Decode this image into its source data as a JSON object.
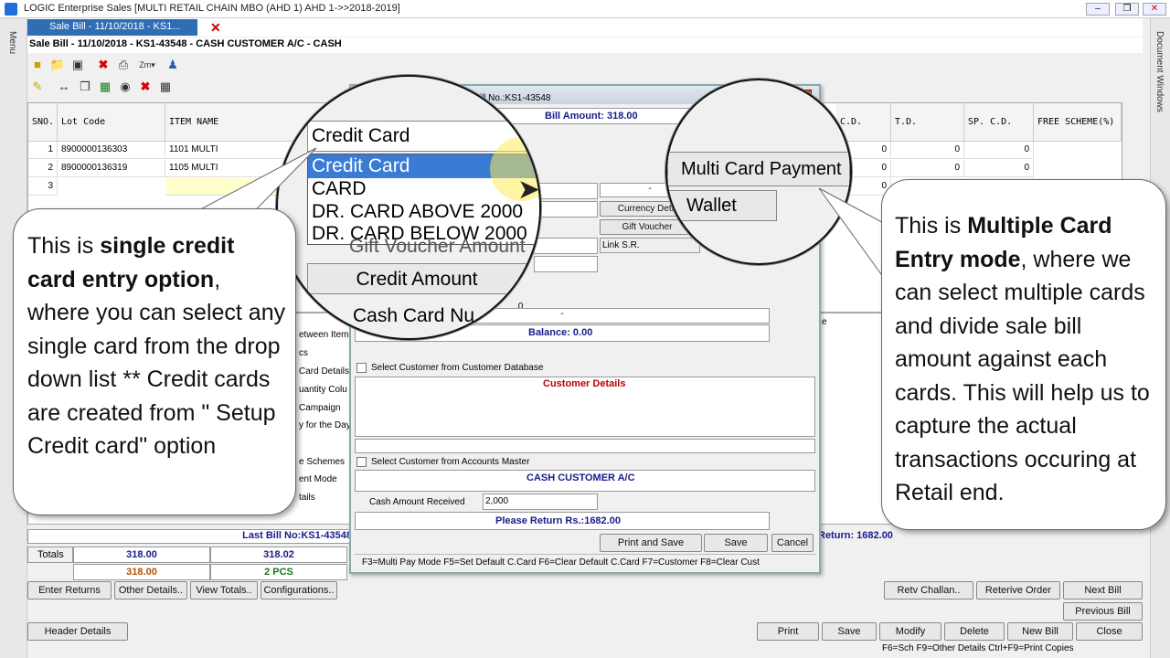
{
  "window": {
    "title": "LOGIC Enterprise Sales  [MULTI RETAIL CHAIN MBO (AHD 1) AHD 1->>2018-2019]"
  },
  "tab": {
    "label": "Sale Bill - 11/10/2018 - KS1..."
  },
  "rails": {
    "left": "Menu",
    "right": "Document Windows"
  },
  "header": {
    "line": "Sale Bill - 11/10/2018 - KS1-43548 - CASH CUSTOMER A/C - CASH"
  },
  "grid": {
    "columns": [
      "SNO.",
      "Lot Code",
      "ITEM NAME",
      "C.D.",
      "T.D.",
      "SP. C.D.",
      "FREE SCHEME(%)"
    ],
    "rows": [
      {
        "sno": "1",
        "lot": "8900000136303",
        "item": "1101 MULTI",
        "cd": "0",
        "td": "0",
        "spcd": "0"
      },
      {
        "sno": "2",
        "lot": "8900000136319",
        "item": "1105 MULTI",
        "cd": "0",
        "td": "0",
        "spcd": "0"
      },
      {
        "sno": "3",
        "lot": "",
        "item": "",
        "cd": "0",
        "td": "",
        "spcd": ""
      }
    ]
  },
  "lower_panel": {
    "items": [
      "etween Item",
      "cs",
      "Card Details",
      "uantity Colu",
      "Campaign",
      "y for the Day",
      "e Schemes",
      "ent Mode",
      "tails"
    ],
    "right_stub": "e"
  },
  "totals": {
    "last_bill": "Last Bill No:KS1-43548",
    "label": "Totals",
    "a1": "318.00",
    "a2": "318.02",
    "b1": "318.00",
    "b2": "2 PCS",
    "return_text": "Return: 1682.00"
  },
  "buttons": {
    "enter_returns": "Enter Returns",
    "other_details": "Other Details..",
    "view_totals": "View Totals..",
    "configurations": "Configurations..",
    "header_details": "Header Details",
    "retv_challan": "Retv Challan..",
    "retrieve_order": "Reterive Order",
    "next_bill": "Next Bill",
    "previous_bill": "Previous Bill",
    "print": "Print",
    "save": "Save",
    "modify": "Modify",
    "delete": "Delete",
    "new_bill": "New Bill",
    "close": "Close"
  },
  "status": {
    "shortcuts": "F6=Sch  F9=Other Details  Ctrl+F9=Print Copies"
  },
  "dialog": {
    "title": "Bill No.:KS1-43548",
    "bill_amount": "Bill Amount: 318.00",
    "dash": "-",
    "currency_btn": "Currency Deta",
    "gift_voucher_btn": "Gift Voucher",
    "link_sr": "Link S.R.",
    "fragment_zero": ".0",
    "balance": "Balance: 0.00",
    "chk_customer_db": "Select Customer from Customer Database",
    "customer_details": "Customer Details",
    "chk_accounts_master": "Select Customer from Accounts Master",
    "account_name": "CASH CUSTOMER A/C",
    "cash_label": "Cash Amount Received",
    "cash_value": "2,000",
    "please_return": "Please Return Rs.:1682.00",
    "print_save": "Print and Save",
    "save": "Save",
    "cancel": "Cancel",
    "shortcuts": "F3=Multi Pay Mode  F5=Set Default C.Card   F6=Clear Default C.Card   F7=Customer F8=Clear Cust"
  },
  "magnifier_left": {
    "selected": "Credit Card",
    "options": [
      "Credit Card",
      "CARD",
      "DR. CARD ABOVE 2000",
      "DR. CARD BELOW 2000"
    ],
    "hidden_label": "Gift Voucher Amount",
    "credit_amount": "Credit Amount",
    "cash_card": "Cash Card Nu"
  },
  "magnifier_right": {
    "multi_card": "Multi Card Payment",
    "wallet": "Wallet"
  },
  "callout_left": {
    "p1": "This is ",
    "b1": "single credit card entry option",
    "p2": ", where you can select any single card from the drop down list ** Credit cards are created from \" Setup Credit card\" option"
  },
  "callout_right": {
    "p1": "This is ",
    "b1": "Multiple Card Entry mode",
    "p2": ", where we can select multiple cards and divide sale bill amount against each cards. This will help us to capture the actual transactions occuring at Retail end."
  },
  "colors": {
    "tab": "#2f6db5",
    "accent_blue": "#1a1a8a",
    "red_text": "#c00000",
    "highlight": "#3a7bd5"
  }
}
